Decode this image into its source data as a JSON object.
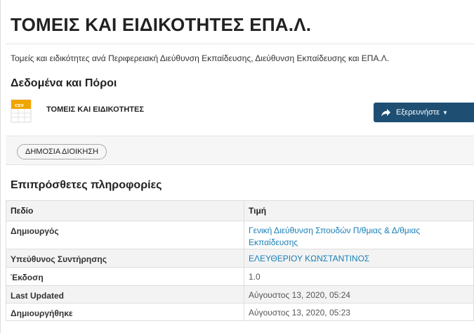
{
  "page": {
    "title": "ΤΟΜΕΙΣ ΚΑΙ ΕΙΔΙΚΟΤΗΤΕΣ ΕΠΑ.Λ.",
    "description": "Τομείς και ειδικότητες ανά Περιφερειακή Διεύθυνση Εκπαίδευσης, Διεύθυνση Εκπαίδευσης και ΕΠΑ.Λ."
  },
  "resources": {
    "heading": "Δεδομένα και Πόροι",
    "items": [
      {
        "format": "csv",
        "icon": "csv-file-icon",
        "name": "ΤΟΜΕΙΣ ΚΑΙ ΕΙΔΙΚΟΤΗΤΕΣ",
        "explore_label": "Εξερευνήστε"
      }
    ]
  },
  "tags": [
    "ΔΗΜΟΣΙΑ ΔΙΟΙΚΗΣΗ"
  ],
  "additional_info": {
    "heading": "Επιπρόσθετες πληροφορίες",
    "columns": [
      "Πεδίο",
      "Τιμή"
    ],
    "rows": [
      {
        "key": "Δημιουργός",
        "value": "Γενική Διεύθυνση Σπουδών Π/θμιας & Δ/θμιας Εκπαίδευσης",
        "link": true
      },
      {
        "key": "Υπεύθυνος Συντήρησης",
        "value": "ΕΛΕΥΘΕΡΙΟΥ ΚΩΝΣΤΑΝΤΙΝΟΣ",
        "link": true
      },
      {
        "key": "Έκδοση",
        "value": "1.0",
        "link": false
      },
      {
        "key": "Last Updated",
        "value": "Αύγουστος 13, 2020, 05:24",
        "link": false
      },
      {
        "key": "Δημιουργήθηκε",
        "value": "Αύγουστος 13, 2020, 05:23",
        "link": false
      }
    ]
  },
  "colors": {
    "button_bg": "#1e4f73",
    "link": "#187fb6",
    "csv_badge": "#f0a500"
  }
}
